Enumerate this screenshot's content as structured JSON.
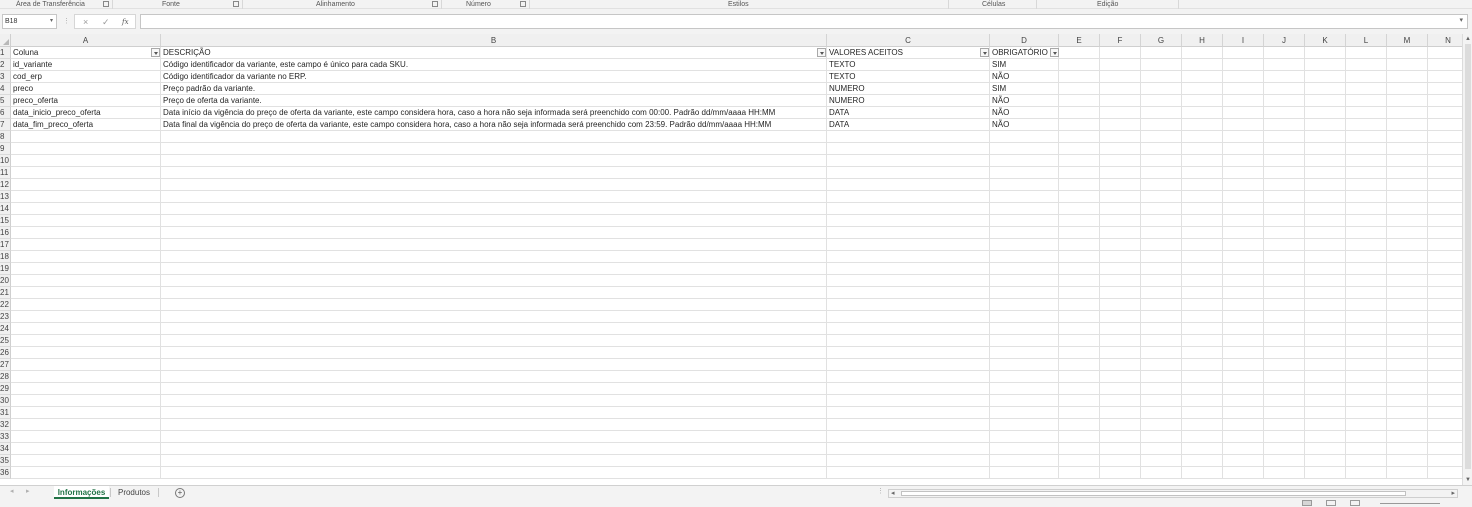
{
  "ribbon": {
    "groups": [
      {
        "label": "Área de Transferência",
        "launcher": true
      },
      {
        "label": "Fonte",
        "launcher": true
      },
      {
        "label": "Alinhamento",
        "launcher": true
      },
      {
        "label": "Número",
        "launcher": true
      },
      {
        "label": "Estilos",
        "launcher": false
      },
      {
        "label": "Células",
        "launcher": false
      },
      {
        "label": "Edição",
        "launcher": false
      }
    ]
  },
  "formula_bar": {
    "name_box": "B18",
    "cancel_icon": "×",
    "enter_icon": "✓",
    "function_icon": "fx",
    "formula": ""
  },
  "sheet": {
    "columns": [
      "A",
      "B",
      "C",
      "D",
      "E",
      "F",
      "G",
      "H",
      "I",
      "J",
      "K",
      "L",
      "M",
      "N"
    ],
    "header_row": [
      "Coluna",
      "DESCRIÇÃO",
      "VALORES ACEITOS",
      "OBRIGATÓRIO"
    ],
    "rows": [
      [
        "id_variante",
        "Código identificador da variante, este campo é único para cada SKU.",
        "TEXTO",
        "SIM"
      ],
      [
        "cod_erp",
        "Código identificador da variante no ERP.",
        "TEXTO",
        "NÃO"
      ],
      [
        "preco",
        "Preço padrão da variante.",
        "NUMERO",
        "SIM"
      ],
      [
        "preco_oferta",
        "Preço de oferta da variante.",
        "NUMERO",
        "NÃO"
      ],
      [
        "data_inicio_preco_oferta",
        "Data início da vigência do preço de oferta da variante, este campo considera hora, caso a hora não seja informada será preenchido com 00:00. Padrão dd/mm/aaaa HH:MM",
        "DATA",
        "NÃO"
      ],
      [
        "data_fim_preco_oferta",
        "Data final da vigência do preço de oferta da variante, este campo considera hora, caso a hora não seja informada será preenchido com 23:59. Padrão dd/mm/aaaa HH:MM",
        "DATA",
        "NÃO"
      ]
    ],
    "visible_row_numbers": [
      "1",
      "2",
      "3",
      "4",
      "5",
      "6",
      "7",
      "8",
      "9",
      "10",
      "11",
      "12",
      "13",
      "14",
      "15",
      "16",
      "17",
      "18",
      "19",
      "20",
      "21",
      "22",
      "23",
      "24",
      "25",
      "26",
      "27",
      "28",
      "29",
      "30",
      "31",
      "32",
      "33",
      "34",
      "35",
      "36"
    ]
  },
  "tabs": {
    "sheets": [
      "Informações",
      "Produtos"
    ],
    "active": "Informações",
    "add_sheet_icon": "+"
  },
  "colors": {
    "accent": "#217346",
    "header_bg": "#f0f0f0",
    "gridline": "#e1e1e1"
  }
}
